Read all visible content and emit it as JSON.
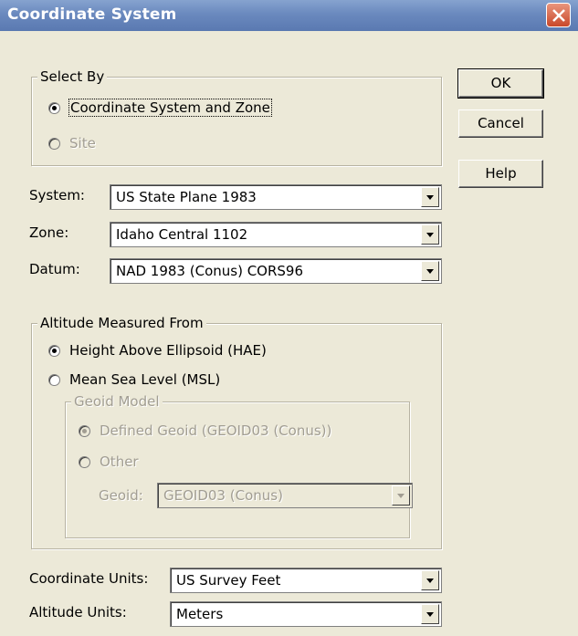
{
  "window": {
    "title": "Coordinate System"
  },
  "buttons": {
    "ok": "OK",
    "cancel": "Cancel",
    "help": "Help"
  },
  "select_by": {
    "legend": "Select By",
    "options": [
      {
        "label": "Coordinate System and Zone",
        "selected": true,
        "enabled": true
      },
      {
        "label": "Site",
        "selected": false,
        "enabled": false
      }
    ]
  },
  "fields": {
    "system": {
      "label": "System:",
      "value": "US State Plane 1983"
    },
    "zone": {
      "label": "Zone:",
      "value": "Idaho Central 1102"
    },
    "datum": {
      "label": "Datum:",
      "value": "NAD 1983 (Conus) CORS96"
    }
  },
  "altitude": {
    "legend": "Altitude Measured From",
    "options": [
      {
        "label": "Height Above Ellipsoid (HAE)",
        "selected": true,
        "enabled": true
      },
      {
        "label": "Mean Sea Level (MSL)",
        "selected": false,
        "enabled": true
      }
    ],
    "geoid_model": {
      "legend": "Geoid Model",
      "options": [
        {
          "label": "Defined Geoid (GEOID03 (Conus))",
          "selected": true,
          "enabled": false
        },
        {
          "label": "Other",
          "selected": false,
          "enabled": false
        }
      ],
      "geoid_label": "Geoid:",
      "geoid_value": "GEOID03 (Conus)"
    }
  },
  "units": {
    "coordinate": {
      "label": "Coordinate Units:",
      "value": "US Survey Feet"
    },
    "altitude": {
      "label": "Altitude Units:",
      "value": "Meters"
    }
  }
}
